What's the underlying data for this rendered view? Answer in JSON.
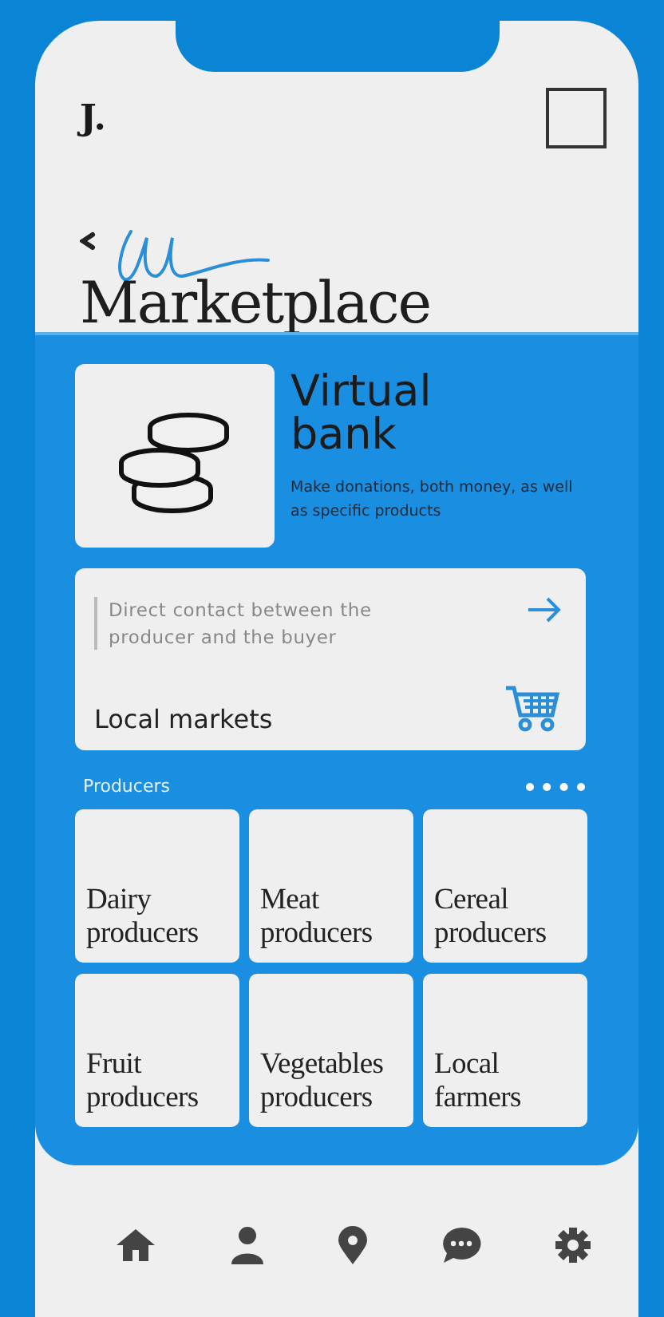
{
  "header": {
    "logo": "J.",
    "title": "Marketplace"
  },
  "virtual_bank": {
    "title": "Virtual bank",
    "description": "Make donations, both money, as well as specific products"
  },
  "local_markets": {
    "description": "Direct contact between the producer and the buyer",
    "title": "Local markets"
  },
  "producers": {
    "heading": "Producers",
    "items": [
      {
        "label": "Dairy producers"
      },
      {
        "label": "Meat producers"
      },
      {
        "label": "Cereal producers"
      },
      {
        "label": "Fruit producers"
      },
      {
        "label": "Vegetables producers"
      },
      {
        "label": "Local farmers"
      }
    ]
  },
  "nav": [
    {
      "kind": "home"
    },
    {
      "kind": "profile"
    },
    {
      "kind": "location"
    },
    {
      "kind": "chat"
    },
    {
      "kind": "settings"
    }
  ]
}
